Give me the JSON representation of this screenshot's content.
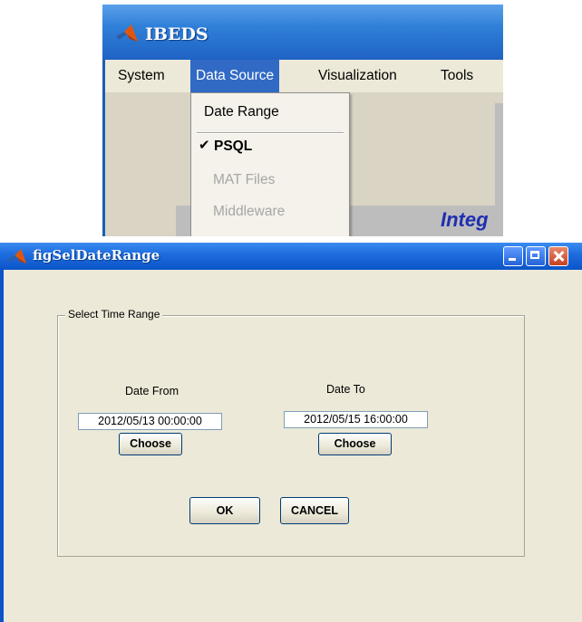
{
  "top_window": {
    "title": "IBEDS",
    "menu": [
      {
        "label": "System"
      },
      {
        "label": "Data Source",
        "active": true
      },
      {
        "label": "Visualization"
      },
      {
        "label": "Tools"
      }
    ],
    "dropdown": {
      "items": [
        {
          "label": "Date Range",
          "enabled": true
        },
        {
          "label": "PSQL",
          "checked": true,
          "enabled": true
        },
        {
          "label": "MAT Files",
          "enabled": false
        },
        {
          "label": "Middleware",
          "enabled": false
        }
      ]
    },
    "background_text": "Integ"
  },
  "dialog": {
    "title": "figSelDateRange",
    "group_label": "Select Time Range",
    "date_from": {
      "label": "Date From",
      "value": "2012/05/13 00:00:00",
      "button": "Choose"
    },
    "date_to": {
      "label": "Date To",
      "value": "2012/05/15 16:00:00",
      "button": "Choose"
    },
    "ok_label": "OK",
    "cancel_label": "CANCEL"
  },
  "colors": {
    "title_bar": "#1f63c4",
    "menu_active": "#316ac5",
    "dialog_bg": "#ece9d8",
    "disabled_text": "#a6a6a6"
  }
}
